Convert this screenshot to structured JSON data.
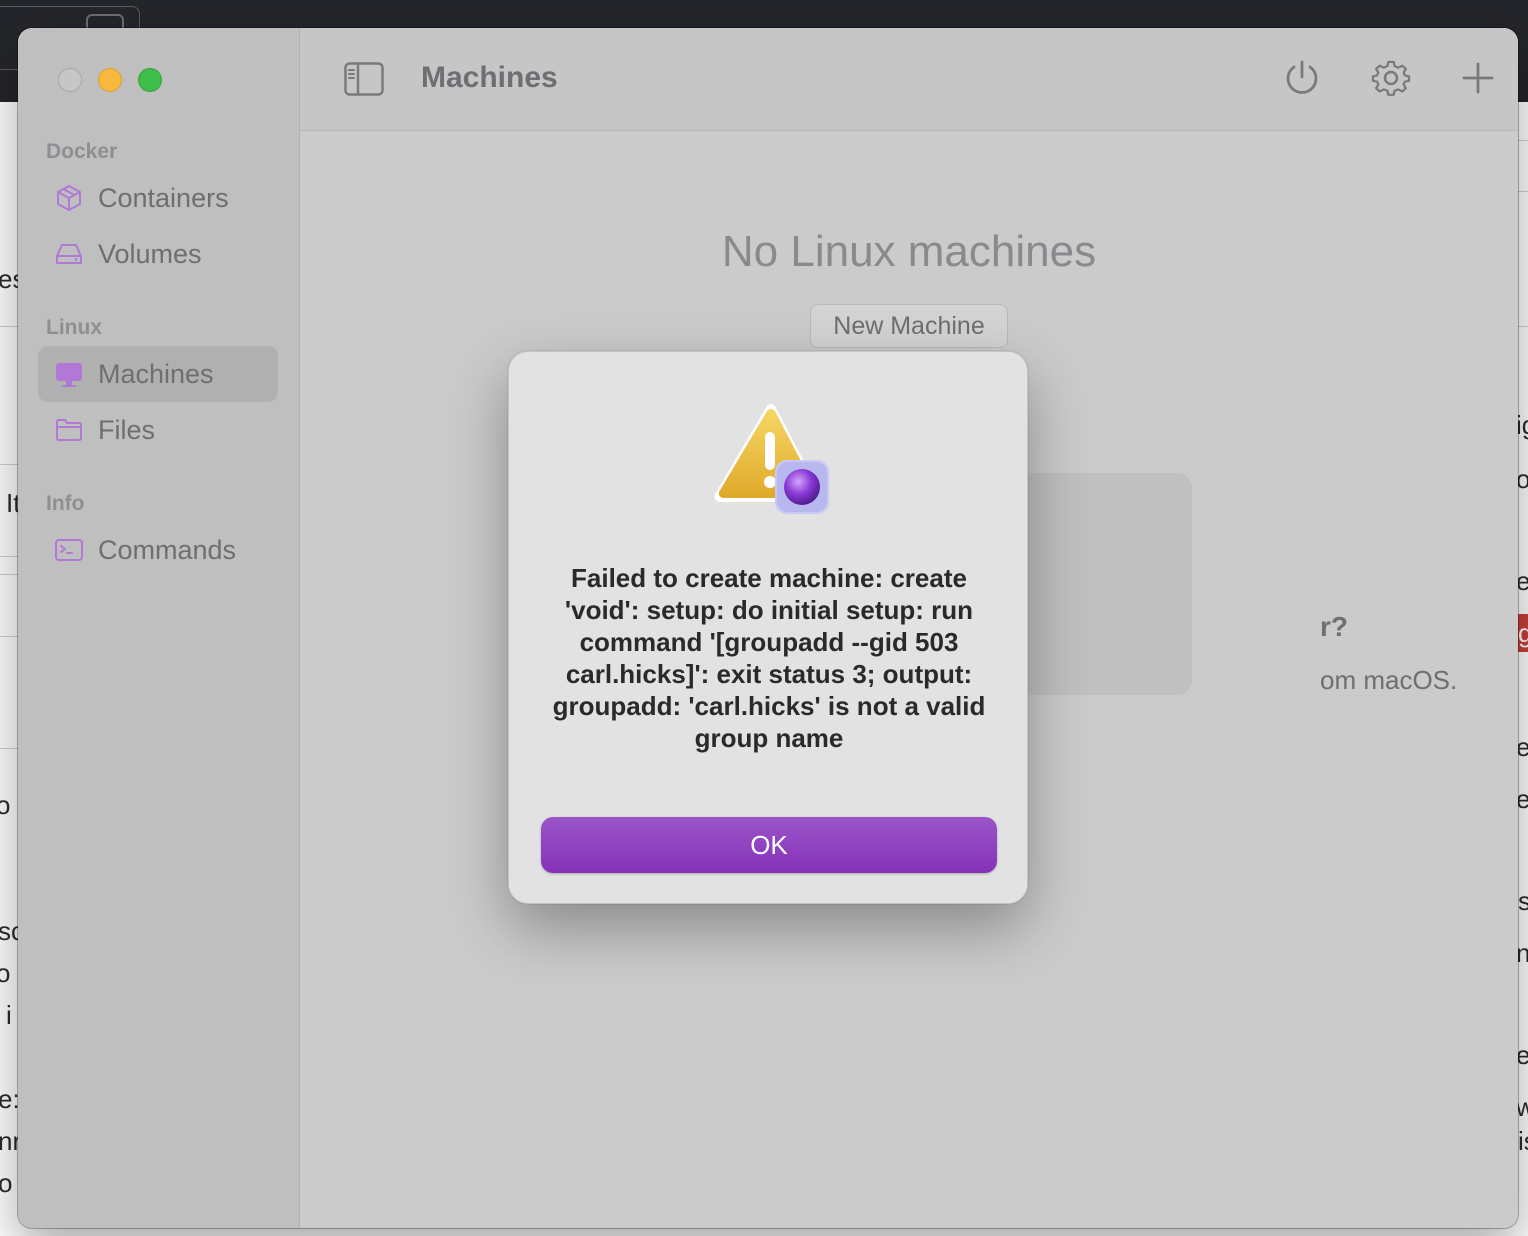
{
  "window": {
    "toolbar_title": "Machines"
  },
  "sidebar": {
    "sections": [
      {
        "header": "Docker",
        "items": [
          {
            "label": "Containers",
            "icon": "cube-icon"
          },
          {
            "label": "Volumes",
            "icon": "drive-icon"
          }
        ]
      },
      {
        "header": "Linux",
        "items": [
          {
            "label": "Machines",
            "icon": "monitor-icon",
            "selected": true
          },
          {
            "label": "Files",
            "icon": "folder-icon"
          }
        ]
      },
      {
        "header": "Info",
        "items": [
          {
            "label": "Commands",
            "icon": "terminal-icon"
          }
        ]
      }
    ]
  },
  "toolbar": {
    "icons": [
      "sidebar-toggle-icon",
      "power-icon",
      "gear-icon",
      "plus-icon"
    ]
  },
  "content": {
    "empty_title": "No Linux machines",
    "new_machine_label": "New Machine",
    "card_heading_fragment": "r?",
    "card_body_fragment": "om macOS."
  },
  "alert": {
    "icon": "warning-triangle-icon",
    "message": "Failed to create machine: create 'void': setup: do initial setup: run command '[groupadd --gid 503 carl.hicks]': exit status 3; output: groupadd: 'carl.hicks' is not a valid group name",
    "ok_label": "OK"
  },
  "colors": {
    "accent": "#8a3bbd",
    "sidebar_icon": "#b178d6",
    "close": "#c6c6c6",
    "minimize": "#f7b93e",
    "maximize": "#3fbf4a"
  },
  "background_fragments": {
    "left": [
      "es",
      "It",
      "o",
      "sc",
      "o",
      "i",
      "e:",
      "nr",
      "o"
    ],
    "right": [
      "ig",
      "o",
      "e",
      "g",
      "e",
      "e",
      "s",
      "n",
      "e",
      "w",
      "is"
    ]
  }
}
